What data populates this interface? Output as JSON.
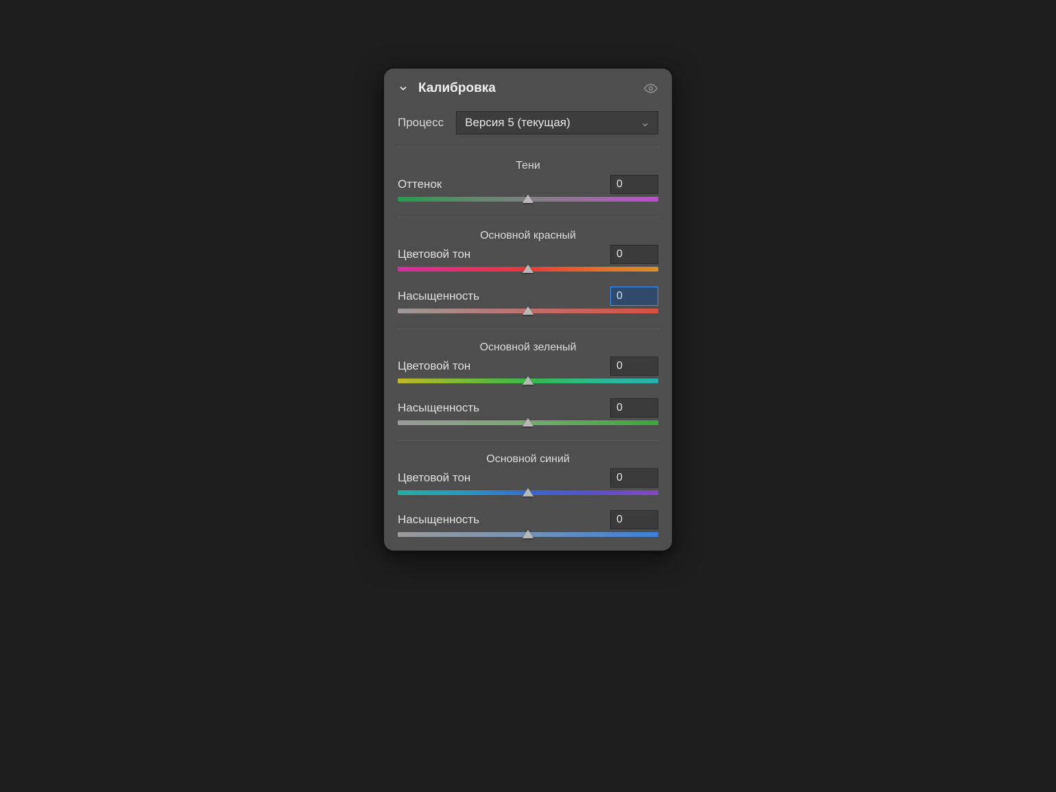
{
  "panel": {
    "title": "Калибровка",
    "process_label": "Процесс",
    "process_value": "Версия 5 (текущая)"
  },
  "groups": {
    "shadows": {
      "title": "Тени",
      "tint_label": "Оттенок",
      "tint_value": "0"
    },
    "red": {
      "title": "Основной красный",
      "hue_label": "Цветовой тон",
      "hue_value": "0",
      "sat_label": "Насыщенность",
      "sat_value": "0"
    },
    "green": {
      "title": "Основной зеленый",
      "hue_label": "Цветовой тон",
      "hue_value": "0",
      "sat_label": "Насыщенность",
      "sat_value": "0"
    },
    "blue": {
      "title": "Основной синий",
      "hue_label": "Цветовой тон",
      "hue_value": "0",
      "sat_label": "Насыщенность",
      "sat_value": "0"
    }
  }
}
